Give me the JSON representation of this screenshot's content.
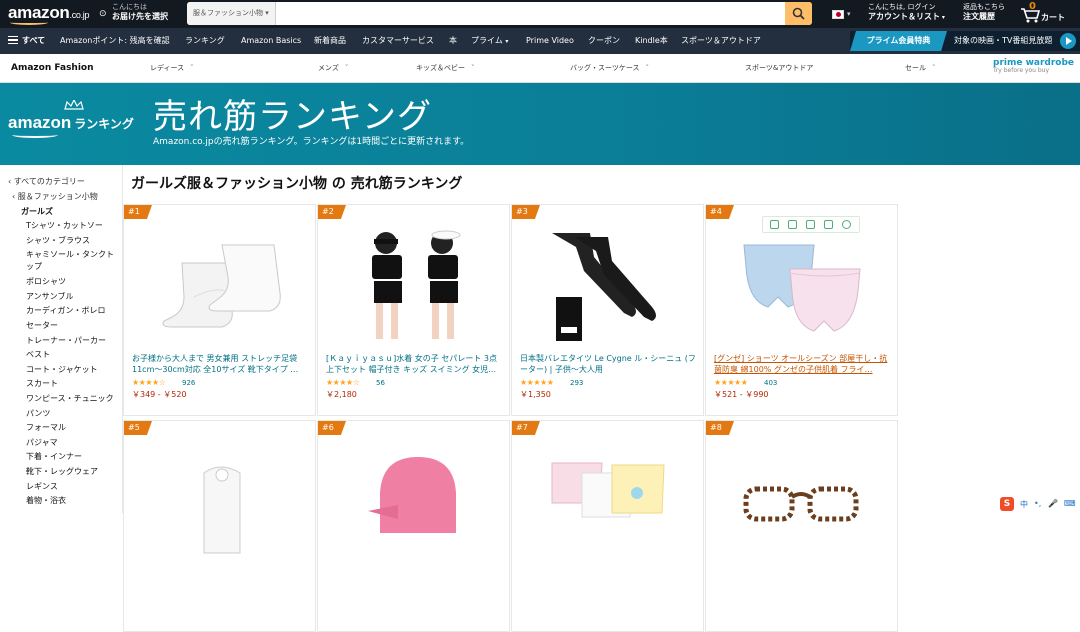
{
  "header": {
    "logo": "amazon",
    "logo_suffix": ".co.jp",
    "deliver_line1": "こんにちは",
    "deliver_line2": "お届け先を選択",
    "search_category": "服＆ファッション小物",
    "search_placeholder": "",
    "account_line1": "こんにちは, ログイン",
    "account_line2": "アカウント＆リスト",
    "orders_line1": "返品もこちら",
    "orders_line2": "注文履歴",
    "cart_count": "0",
    "cart_label": "カート",
    "search_button_color": "#febd69"
  },
  "nav": {
    "all_label": "すべて",
    "items": [
      "Amazonポイント: 残高を確認",
      "ランキング",
      "Amazon Basics",
      "新着商品",
      "カスタマーサービス",
      "本",
      "プライム",
      "Prime Video",
      "クーポン",
      "Kindle本",
      "スポーツ＆アウトドア"
    ],
    "prime_tag": "プライム会員特典",
    "prime_text": "対象の映画・TV番組見放題"
  },
  "subnav": {
    "brand": "Amazon Fashion",
    "items": [
      "レディース",
      "メンズ",
      "キッズ＆ベビー",
      "バッグ・スーツケース",
      "スポーツ&アウトドア",
      "セール"
    ],
    "wardrobe_title": "prime wardrobe",
    "wardrobe_sub": "Try before you buy"
  },
  "hero": {
    "logo": "amazon",
    "logo_ranking": "ランキング",
    "title": "売れ筋ランキング",
    "subtitle": "Amazon.co.jpの売れ筋ランキング。ランキングは1時間ごとに更新されます。",
    "background": "#0b7d97"
  },
  "sidebar": {
    "all_categories": "‹ すべてのカテゴリー",
    "parent": "‹ 服＆ファッション小物",
    "current": "ガールズ",
    "items": [
      "Tシャツ・カットソー",
      "シャツ・ブラウス",
      "キャミソール・タンクト",
      "ップ",
      "ポロシャツ",
      "アンサンブル",
      "カーディガン・ボレロ",
      "セーター",
      "トレーナー・パーカー",
      "ベスト",
      "コート・ジャケット",
      "スカート",
      "ワンピース・チュニック",
      "パンツ",
      "フォーマル",
      "パジャマ",
      "下着・インナー",
      "靴下・レッグウェア",
      "レギンス",
      "着物・浴衣"
    ]
  },
  "main": {
    "title": "ガールズ服＆ファッション小物 の 売れ筋ランキング",
    "products": [
      {
        "rank": "#1",
        "title": "お子様から大人まで 男女兼用 ストレッチ足袋 11cm〜30cm対応 全10サイズ 靴下タイプ …",
        "stars": "★★★★☆",
        "rating": 4.0,
        "reviews": "926",
        "price": "￥349 - ￥520",
        "image": "white-tabi-socks"
      },
      {
        "rank": "#2",
        "title": "[Ｋａｙｉｙａｓｕ]水着 女の子 セパレート 3点 上下セット 帽子付き キッズ スイミング 女児…",
        "stars": "★★★★☆",
        "rating": 4.0,
        "reviews": "56",
        "price": "￥2,180",
        "image": "girls-swimsuit"
      },
      {
        "rank": "#3",
        "title": "日本製バレエタイツ Le Cygne ル・シーニュ (フーター) | 子供〜大人用",
        "stars": "★★★★★",
        "rating": 4.5,
        "reviews": "293",
        "price": "￥1,350",
        "image": "black-ballet-tights"
      },
      {
        "rank": "#4",
        "title": "[グンゼ] ショーツ オールシーズン 部屋干し・抗菌防臭 綿100% グンゼの子供肌着 フライ…",
        "stars": "★★★★★",
        "rating": 4.5,
        "reviews": "403",
        "price": "￥521 - ￥990",
        "image": "girls-shorts-pack"
      },
      {
        "rank": "#5",
        "image": "lace-socks"
      },
      {
        "rank": "#6",
        "image": "pink-swim-cap"
      },
      {
        "rank": "#7",
        "image": "printed-shorts"
      },
      {
        "rank": "#8",
        "image": "leopard-glasses"
      }
    ]
  },
  "ime": {
    "logo": "S",
    "items": [
      "中",
      "•,",
      "🎤",
      "⌨"
    ]
  }
}
